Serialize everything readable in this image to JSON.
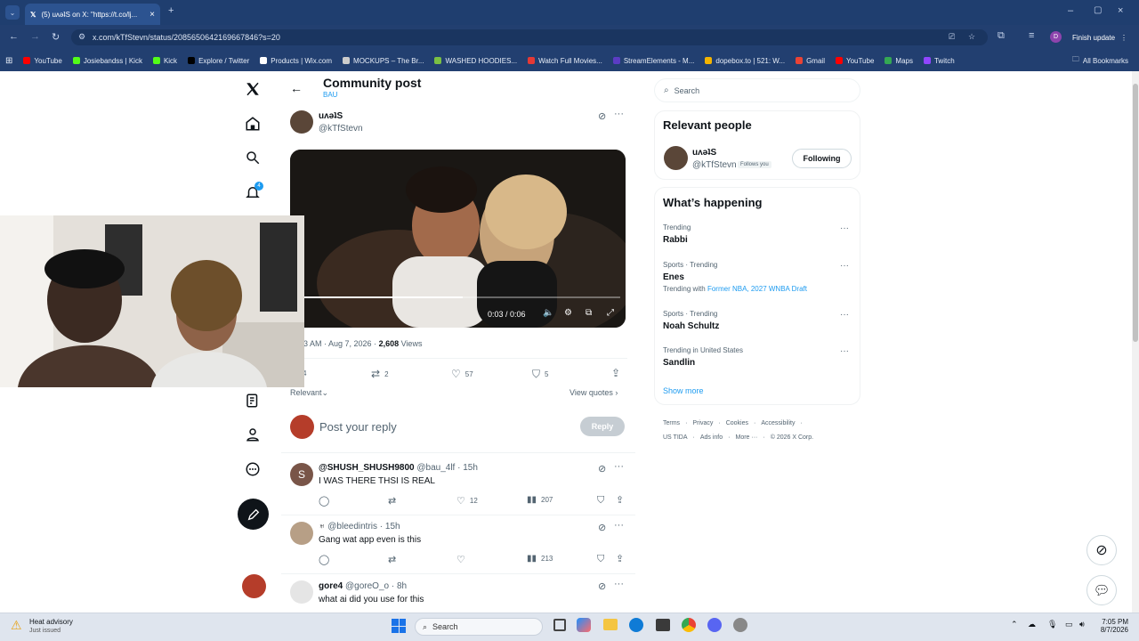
{
  "browser": {
    "tab_title": "(5) uʌǝʇS on X: \"https://t.co/lj...",
    "url": "x.com/kTfStevn/status/2085650642169667846?s=20",
    "finish_update": "Finish update",
    "all_bookmarks": "All Bookmarks",
    "bookmarks": [
      {
        "label": "YouTube",
        "color": "#ff0000"
      },
      {
        "label": "Josiebandss | Kick",
        "color": "#53fc18"
      },
      {
        "label": "Kick",
        "color": "#53fc18"
      },
      {
        "label": "Explore / Twitter",
        "color": "#000000"
      },
      {
        "label": "Products | Wix.com",
        "color": "#ffffff"
      },
      {
        "label": "MOCKUPS – The Br...",
        "color": "#cccccc"
      },
      {
        "label": "WASHED HOODIES...",
        "color": "#7bc043"
      },
      {
        "label": "Watch Full Movies...",
        "color": "#e53935"
      },
      {
        "label": "StreamElements - M...",
        "color": "#5b3cc4"
      },
      {
        "label": "dopebox.to | 521: W...",
        "color": "#f4b400"
      },
      {
        "label": "Gmail",
        "color": "#ea4335"
      },
      {
        "label": "YouTube",
        "color": "#ff0000"
      },
      {
        "label": "Maps",
        "color": "#34a853"
      },
      {
        "label": "Twitch",
        "color": "#9146ff"
      }
    ]
  },
  "header": {
    "title": "Community post",
    "subtitle": "BAU"
  },
  "post": {
    "author_name": "uʌǝʇS",
    "author_handle": "@kTfStevn",
    "video_time": "0:03 / 0:06",
    "video_progress": 0.5,
    "meta_time": "3 AM · Aug 7, 2026 · ",
    "views_count": "2,608",
    "views_label": " Views",
    "replies": "4",
    "reposts": "2",
    "likes": "57",
    "bookmarks": "5",
    "sort_label": "Relevant",
    "view_quotes": "View quotes"
  },
  "reply_composer": {
    "placeholder": "Post your reply",
    "button": "Reply"
  },
  "replies": [
    {
      "name": "@SHUSH_SHUSH9800",
      "handle": "@bau_4lf · 15h",
      "text": "I WAS THERE THSI IS REAL",
      "likes": "12",
      "views": "207",
      "avatar_letter": "S"
    },
    {
      "name": "♅",
      "handle": "@bleedintris · 15h",
      "text": "Gang wat app even is this",
      "likes": "",
      "views": "213",
      "avatar_letter": ""
    },
    {
      "name": "gore4",
      "handle": "@goreO_o · 8h",
      "text": "what ai did you use for this",
      "likes": "",
      "views": "",
      "avatar_letter": ""
    }
  ],
  "sidebar": {
    "search_placeholder": "Search",
    "relevant_title": "Relevant people",
    "person_name": "uʌǝʇS",
    "person_handle": "@kTfStevn",
    "follows_you": "Follows you",
    "following_button": "Following",
    "happening_title": "What’s happening",
    "trends": [
      {
        "meta": "Trending",
        "name": "Rabbi",
        "extra_prefix": "",
        "extra": ""
      },
      {
        "meta": "Sports · Trending",
        "name": "Enes",
        "extra_prefix": "Trending with ",
        "extra": "Former NBA, 2027 WNBA Draft"
      },
      {
        "meta": "Sports · Trending",
        "name": "Noah Schultz",
        "extra_prefix": "",
        "extra": ""
      },
      {
        "meta": "Trending in United States",
        "name": "Sandlin",
        "extra_prefix": "",
        "extra": ""
      }
    ],
    "show_more": "Show more",
    "footer_line1": [
      "Terms",
      "Privacy",
      "Cookies",
      "Accessibility"
    ],
    "footer_line2": [
      "US TIDA",
      "Ads info",
      "More ···",
      "© 2026 X Corp."
    ]
  },
  "nav": {
    "notification_badge": "4"
  },
  "taskbar": {
    "weather_title": "Heat advisory",
    "weather_sub": "Just issued",
    "search": "Search",
    "time": "7:05 PM",
    "date": "8/7/2026"
  }
}
